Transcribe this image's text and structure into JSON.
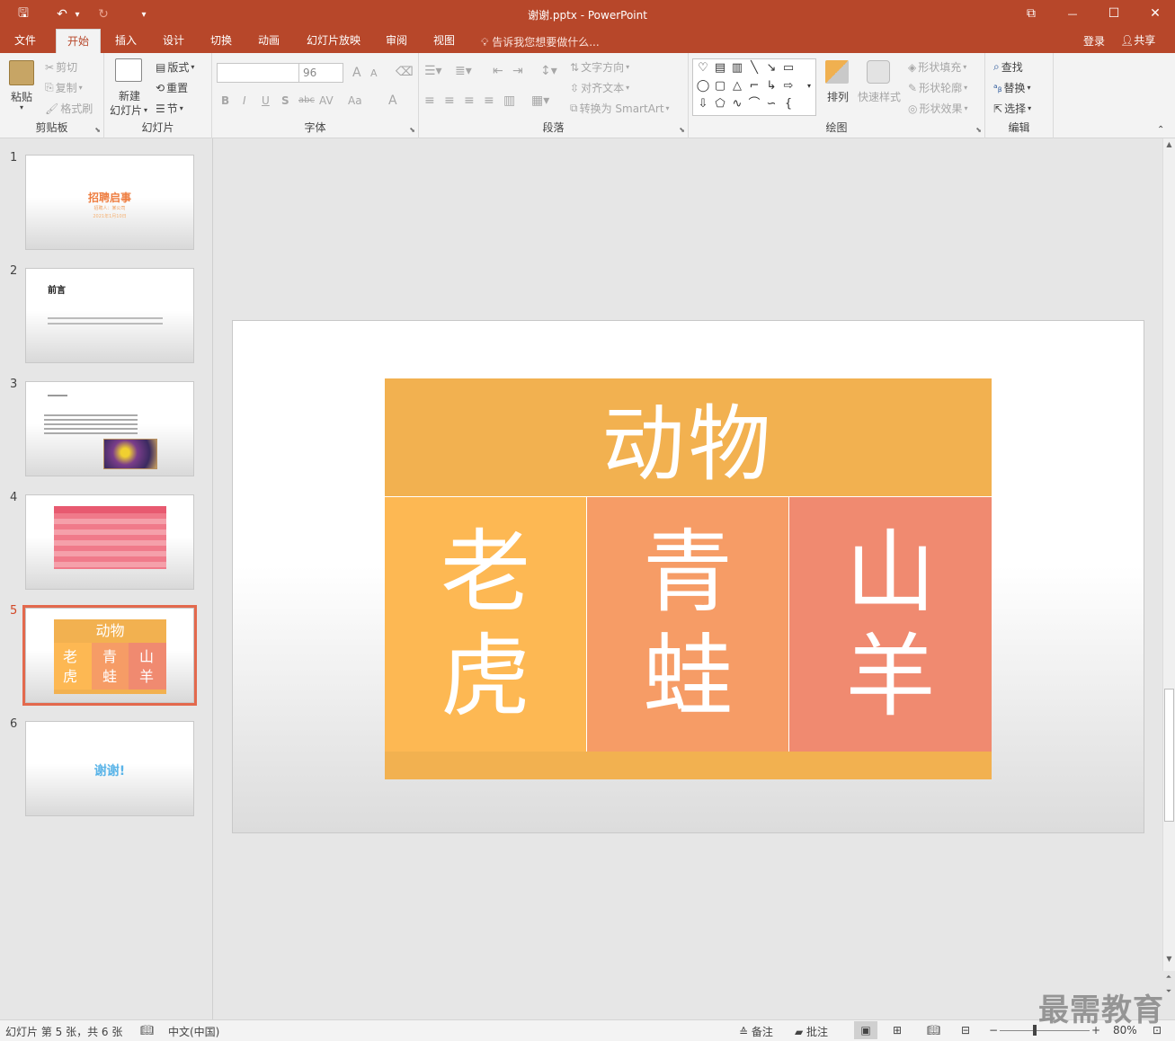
{
  "window": {
    "title": "谢谢.pptx - PowerPoint",
    "qat": {
      "save": "🖫",
      "undo": "↶",
      "undo_drop": "▾",
      "redo": "↻",
      "customize": "▾"
    },
    "controls": {
      "restore_ribbon": "⧉",
      "minimize": "—",
      "maximize": "☐",
      "close": "✕"
    }
  },
  "tabs": [
    "文件",
    "开始",
    "插入",
    "设计",
    "切换",
    "动画",
    "幻灯片放映",
    "审阅",
    "视图"
  ],
  "tell_me": "告诉我您想要做什么...",
  "login": "登录",
  "share": "共享",
  "ribbon": {
    "clipboard": {
      "label": "剪贴板",
      "paste": "粘贴",
      "cut": "剪切",
      "copy": "复制",
      "format_painter": "格式刷"
    },
    "slides": {
      "label": "幻灯片",
      "new_slide": "新建",
      "new_slide2": "幻灯片",
      "layout": "版式",
      "reset": "重置",
      "section": "节"
    },
    "font": {
      "label": "字体",
      "font_name": "",
      "font_size": "96",
      "bold": "B",
      "italic": "I",
      "underline": "U",
      "shadow": "S",
      "strike": "abc",
      "spacing": "AV",
      "case": "Aa",
      "color": "A",
      "grow": "A",
      "shrink": "A"
    },
    "paragraph": {
      "label": "段落",
      "text_direction": "文字方向",
      "align_text": "对齐文本",
      "smartart": "转换为 SmartArt"
    },
    "drawing": {
      "label": "绘图",
      "arrange": "排列",
      "quick_styles": "快速样式",
      "fill": "形状填充",
      "outline": "形状轮廓",
      "effects": "形状效果"
    },
    "editing": {
      "label": "编辑",
      "find": "查找",
      "replace": "替换",
      "select": "选择"
    }
  },
  "thumbnails": [
    {
      "num": "1",
      "title": "招聘启事",
      "sub1": "招聘人：某公司",
      "sub2": "2021年1月10日"
    },
    {
      "num": "2",
      "title": "前言"
    },
    {
      "num": "3"
    },
    {
      "num": "4"
    },
    {
      "num": "5",
      "title": "动物",
      "cells": [
        "老虎",
        "青蛙",
        "山羊"
      ]
    },
    {
      "num": "6",
      "title": "谢谢!"
    }
  ],
  "slide": {
    "header": "动物",
    "cells": [
      {
        "line1": "老",
        "line2": "虎"
      },
      {
        "line1": "青",
        "line2": "蛙"
      },
      {
        "line1": "山",
        "line2": "羊"
      }
    ]
  },
  "colors": {
    "header": "#f2b150",
    "cell1": "#fdb853",
    "cell2": "#f69c66",
    "cell3": "#f08a70",
    "accent": "#b7472a"
  },
  "status": {
    "slide_info": "幻灯片 第 5 张，共 6 张",
    "language": "中文(中国)",
    "notes": "备注",
    "comments": "批注",
    "zoom": "80%"
  },
  "watermark": "最需教育"
}
